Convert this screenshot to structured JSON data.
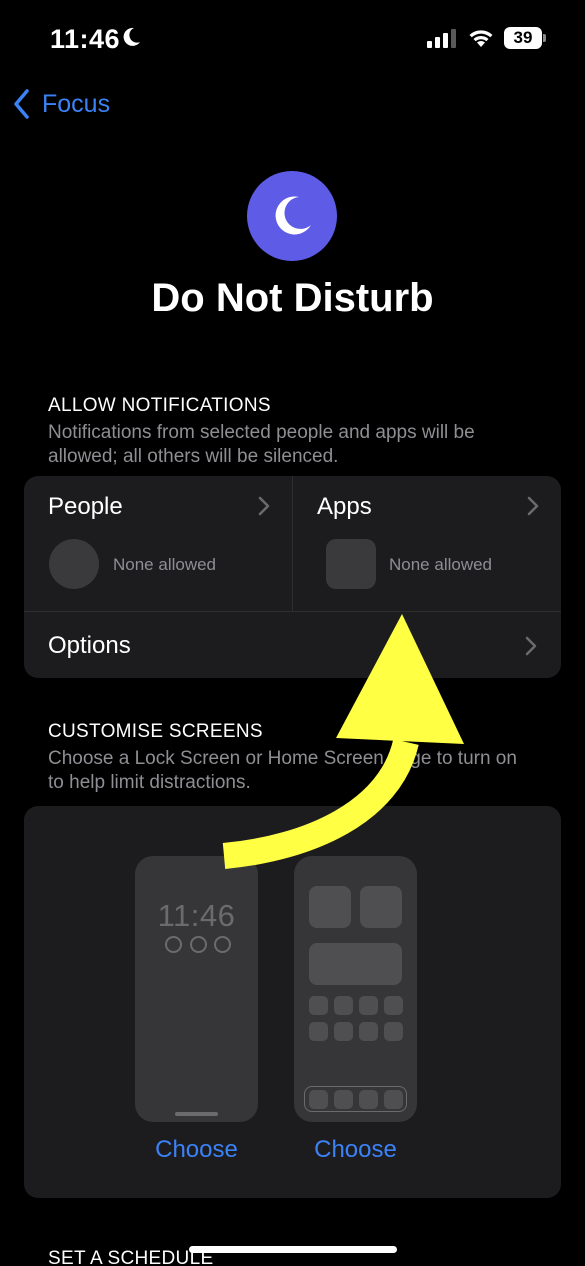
{
  "status_bar": {
    "time": "11:46",
    "battery": "39"
  },
  "nav": {
    "back_label": "Focus"
  },
  "header": {
    "title": "Do Not Disturb",
    "icon": "moon-icon",
    "icon_color": "#5e5ce6"
  },
  "allow_notifications": {
    "header": "ALLOW NOTIFICATIONS",
    "description": "Notifications from selected people and apps will be allowed; all others will be silenced.",
    "people": {
      "label": "People",
      "value": "None allowed"
    },
    "apps": {
      "label": "Apps",
      "value": "None allowed"
    },
    "options": {
      "label": "Options"
    }
  },
  "customise_screens": {
    "header": "CUSTOMISE SCREENS",
    "description": "Choose a Lock Screen or Home Screen page to turn on to help limit distractions.",
    "lock_screen": {
      "time": "11:46",
      "choose_label": "Choose"
    },
    "home_screen": {
      "choose_label": "Choose"
    }
  },
  "schedule": {
    "header": "SET A SCHEDULE"
  },
  "colors": {
    "accent": "#3b82f6",
    "background": "#000000",
    "card": "#1c1c1e",
    "annotation_arrow": "#ffff44"
  }
}
